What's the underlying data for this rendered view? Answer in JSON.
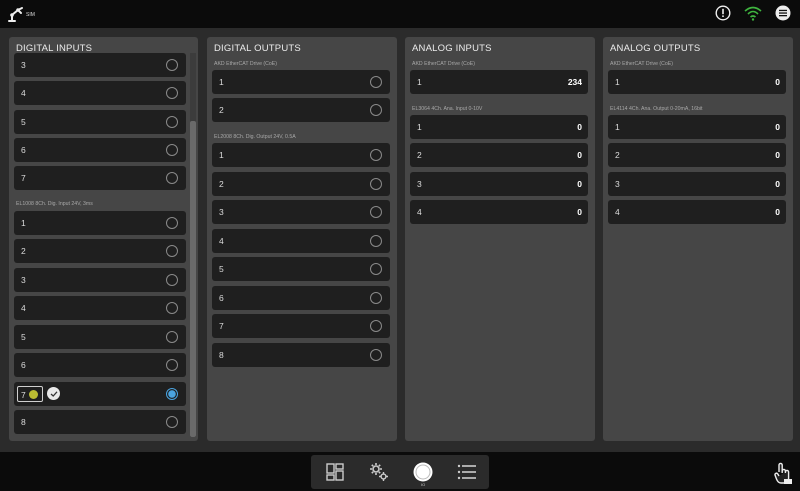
{
  "topbar": {
    "logo_text": "SIM",
    "icons": [
      "alert-icon",
      "wifi-icon",
      "menu-icon"
    ]
  },
  "panels": {
    "digital_inputs": {
      "title": "DIGITAL INPUTS",
      "group1_rows": [
        "3",
        "4",
        "5",
        "6",
        "7"
      ],
      "group2_label": "EL1008 8Ch. Dig. Input 24V, 3ms",
      "group2_rows": [
        "1",
        "2",
        "3",
        "4",
        "5",
        "6",
        "7",
        "8"
      ],
      "editing_row_value": "7"
    },
    "digital_outputs": {
      "title": "DIGITAL OUTPUTS",
      "group1_label": "AKD EtherCAT Drive (CoE)",
      "group1_rows": [
        "1",
        "2"
      ],
      "group2_label": "EL2008 8Ch. Dig. Output 24V, 0.5A",
      "group2_rows": [
        "1",
        "2",
        "3",
        "4",
        "5",
        "6",
        "7",
        "8"
      ]
    },
    "analog_inputs": {
      "title": "ANALOG INPUTS",
      "group1_label": "AKD EtherCAT Drive (CoE)",
      "group1_rows": [
        {
          "idx": "1",
          "val": "234"
        }
      ],
      "group2_label": "EL3064 4Ch. Ana. Input 0-10V",
      "group2_rows": [
        {
          "idx": "1",
          "val": "0"
        },
        {
          "idx": "2",
          "val": "0"
        },
        {
          "idx": "3",
          "val": "0"
        },
        {
          "idx": "4",
          "val": "0"
        }
      ]
    },
    "analog_outputs": {
      "title": "ANALOG OUTPUTS",
      "group1_label": "AKD EtherCAT Drive (CoE)",
      "group1_rows": [
        {
          "idx": "1",
          "val": "0"
        }
      ],
      "group2_label": "EL4114 4Ch. Ana. Output 0-20mA, 16bit",
      "group2_rows": [
        {
          "idx": "1",
          "val": "0"
        },
        {
          "idx": "2",
          "val": "0"
        },
        {
          "idx": "3",
          "val": "0"
        },
        {
          "idx": "4",
          "val": "0"
        }
      ]
    }
  },
  "dock": {
    "items": [
      "dashboard-icon",
      "settings-gears-icon",
      "io-icon",
      "list-icon"
    ],
    "active_label": "IO"
  },
  "colors": {
    "accent": "#4aa3df",
    "panel_bg": "#464646",
    "row_bg": "#1f1f1f",
    "wifi": "#3fb43f"
  }
}
